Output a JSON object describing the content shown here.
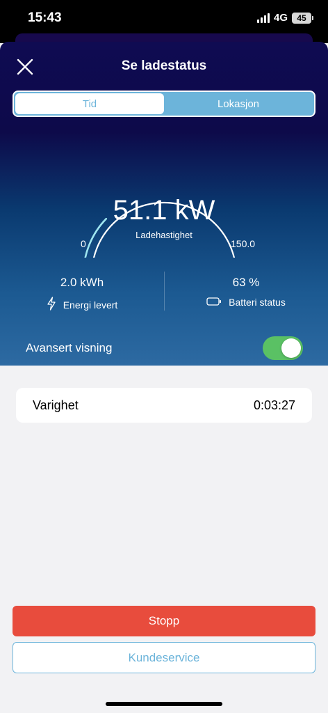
{
  "status_bar": {
    "time": "15:43",
    "network": "4G",
    "battery": "45"
  },
  "header": {
    "title": "Se ladestatus",
    "close_icon": "close-icon"
  },
  "tabs": [
    {
      "label": "Tid",
      "active": true
    },
    {
      "label": "Lokasjon",
      "active": false
    }
  ],
  "gauge": {
    "value_text": "51.1 kW",
    "label": "Ladehastighet",
    "min_label": "0",
    "max_label": "150.0",
    "value": 51.1,
    "min": 0,
    "max": 150.0
  },
  "stats": {
    "energy": {
      "value": "2.0 kWh",
      "label": "Energi levert",
      "icon": "lightning-icon"
    },
    "battery": {
      "value": "63 %",
      "label": "Batteri status",
      "icon": "battery-icon"
    }
  },
  "advanced": {
    "label": "Avansert visning",
    "enabled": true
  },
  "duration": {
    "label": "Varighet",
    "value": "0:03:27"
  },
  "actions": {
    "stop_label": "Stopp",
    "support_label": "Kundeservice"
  },
  "colors": {
    "accent": "#6cb4da",
    "stop": "#e84c3d",
    "toggle_on": "#5ac164",
    "gauge_progress": "#9fe6f0"
  }
}
